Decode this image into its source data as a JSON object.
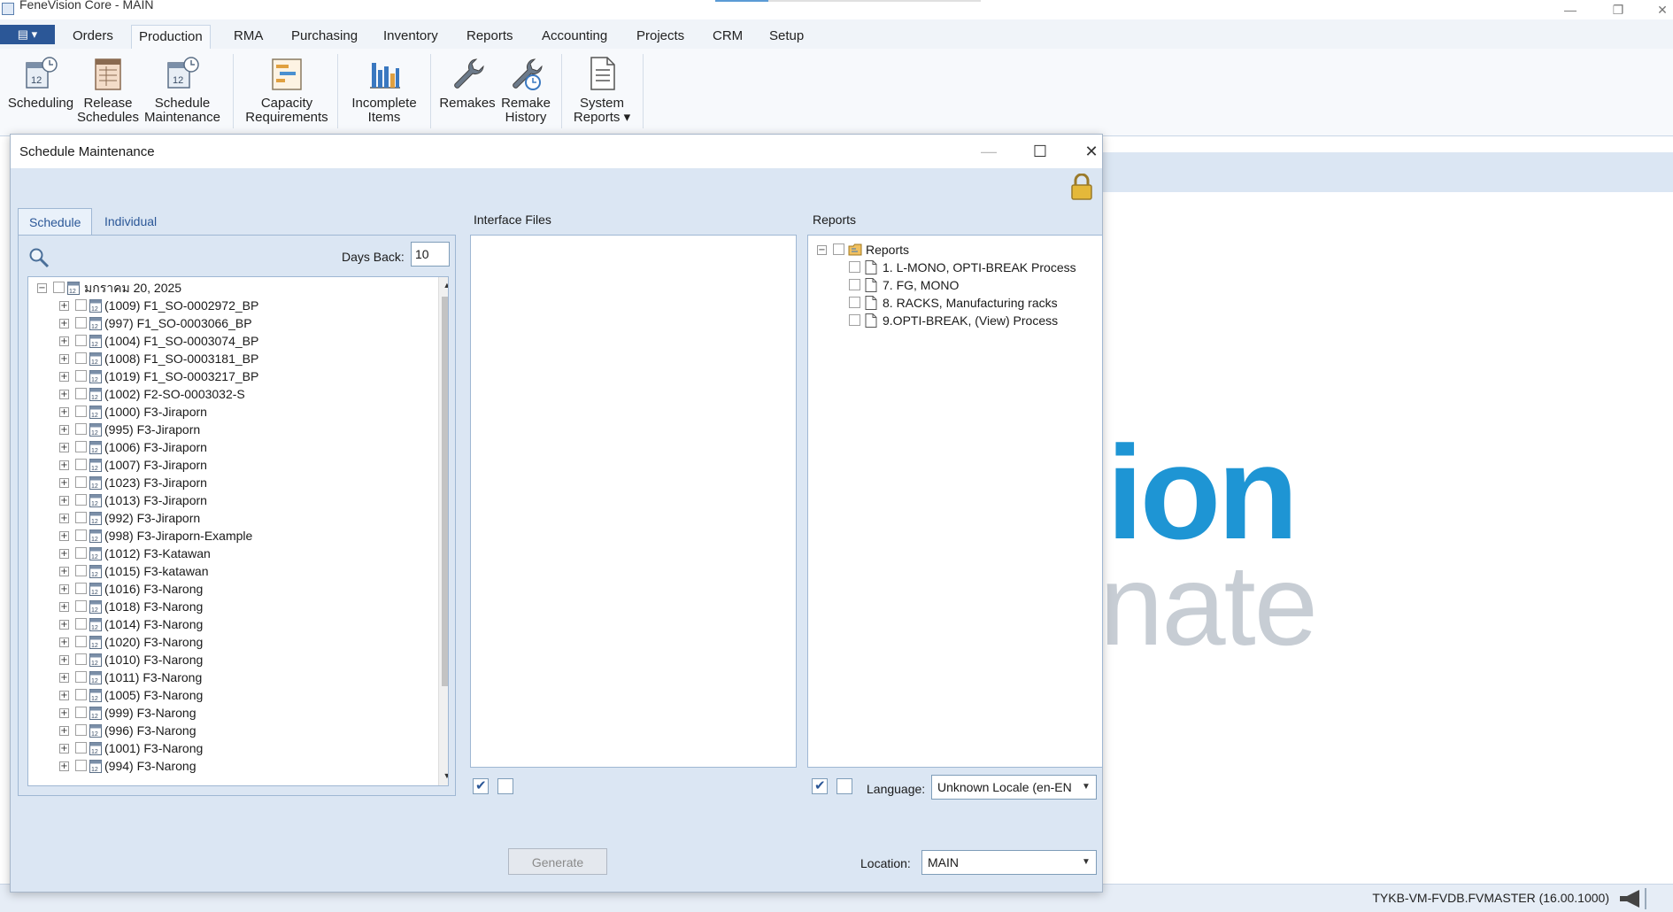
{
  "window": {
    "title": "FeneVision Core - MAIN",
    "minimize": "—",
    "restore": "❐",
    "close": "✕"
  },
  "menubar": {
    "app_menu": "▤ ▾",
    "tabs": [
      "Orders",
      "Production",
      "RMA",
      "Purchasing",
      "Inventory",
      "Reports",
      "Accounting",
      "Projects",
      "CRM",
      "Setup"
    ],
    "active": "Production"
  },
  "ribbon": {
    "scheduling": [
      "Scheduling",
      ""
    ],
    "release_schedules": [
      "Release",
      "Schedules"
    ],
    "schedule_maintenance": [
      "Schedule",
      "Maintenance"
    ],
    "capacity_requirements": [
      "Capacity",
      "Requirements"
    ],
    "incomplete_items": [
      "Incomplete",
      "Items"
    ],
    "remakes": [
      "Remakes",
      ""
    ],
    "remake_history": [
      "Remake",
      "History"
    ],
    "system_reports": [
      "System",
      "Reports ▾"
    ]
  },
  "background": {
    "logo_top": "ion",
    "logo_bottom": "nate"
  },
  "statusbar": {
    "db": "TYKB-VM-FVDB.FVMASTER (16.00.1000)"
  },
  "dialog": {
    "title": "Schedule Maintenance",
    "tabs": {
      "schedule": "Schedule",
      "individual": "Individual"
    },
    "days_back_label": "Days Back:",
    "days_back_value": "10",
    "tree": {
      "root": "มกราคม 20, 2025",
      "items": [
        "(1009) F1_SO-0002972_BP",
        "(997) F1_SO-0003066_BP",
        "(1004) F1_SO-0003074_BP",
        "(1008) F1_SO-0003181_BP",
        "(1019) F1_SO-0003217_BP",
        "(1002) F2-SO-0003032-S",
        "(1000) F3-Jiraporn",
        "(995) F3-Jiraporn",
        "(1006) F3-Jiraporn",
        "(1007) F3-Jiraporn",
        "(1023) F3-Jiraporn",
        "(1013) F3-Jiraporn",
        "(992) F3-Jiraporn",
        "(998) F3-Jiraporn-Example",
        "(1012) F3-Katawan",
        "(1015) F3-katawan",
        "(1016) F3-Narong",
        "(1018) F3-Narong",
        "(1014) F3-Narong",
        "(1020) F3-Narong",
        "(1010) F3-Narong",
        "(1011) F3-Narong",
        "(1005) F3-Narong",
        "(999) F3-Narong",
        "(996) F3-Narong",
        "(1001) F3-Narong",
        "(994) F3-Narong"
      ]
    },
    "interface_files_label": "Interface Files",
    "reports_label": "Reports",
    "reports_tree": {
      "root": "Reports",
      "items": [
        "1. L-MONO, OPTI-BREAK Process",
        "7. FG, MONO",
        "8. RACKS, Manufacturing racks",
        "9.OPTI-BREAK, (View) Process"
      ]
    },
    "language_label": "Language:",
    "language_value": "Unknown Locale (en-EN",
    "generate_label": "Generate",
    "location_label": "Location:",
    "location_value": "MAIN"
  }
}
